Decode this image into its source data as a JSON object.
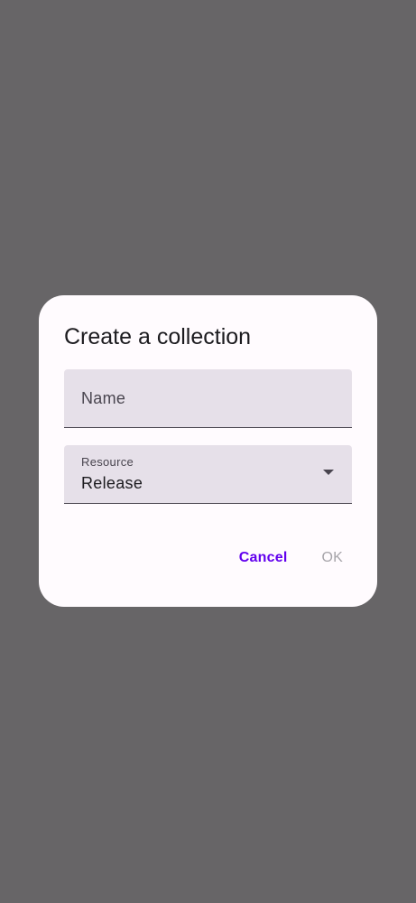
{
  "dialog": {
    "title": "Create a collection",
    "name_field": {
      "placeholder": "Name",
      "value": ""
    },
    "resource_field": {
      "label": "Resource",
      "value": "Release",
      "icon": "arrow-drop-down-icon"
    },
    "actions": {
      "cancel_label": "Cancel",
      "ok_label": "OK"
    }
  },
  "colors": {
    "scrim": "#676567",
    "surface": "#fffbfe",
    "field_bg": "#e6e0e9",
    "primary": "#6200ee",
    "disabled": "#a7a5aa"
  }
}
